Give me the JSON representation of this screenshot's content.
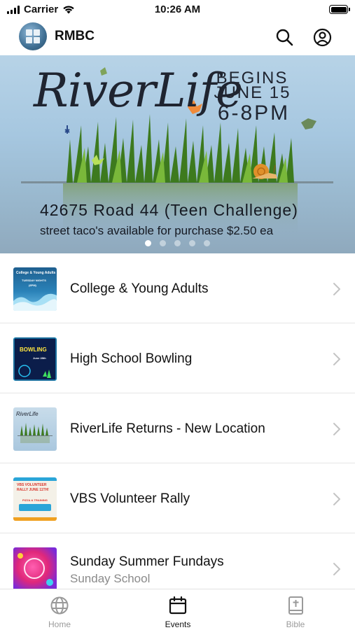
{
  "status_bar": {
    "carrier": "Carrier",
    "time": "10:26 AM"
  },
  "header": {
    "title": "RMBC",
    "icons": [
      "search-icon",
      "account-icon"
    ]
  },
  "banner": {
    "script_title": "RiverLife",
    "begins": "BEGINS",
    "date": "JUNE 15",
    "time": "6-8PM",
    "address": "42675 Road 44 (Teen Challenge)",
    "subtitle": "street taco's available for purchase $2.50 ea",
    "page_count": 5,
    "active_page": 1
  },
  "events": [
    {
      "title": "College & Young Adults",
      "subtitle": "",
      "thumb": {
        "line1": "College & Young Adults",
        "line2": "TUESDAY NIGHTS",
        "line3": "(6PM)"
      }
    },
    {
      "title": "High School Bowling",
      "subtitle": "",
      "thumb": {
        "line1": "BOWLING",
        "line2": "June 28th"
      }
    },
    {
      "title": "RiverLife Returns - New Location",
      "subtitle": "",
      "thumb": {
        "line1": "RiverLife"
      }
    },
    {
      "title": "VBS Volunteer Rally",
      "subtitle": "",
      "thumb": {
        "line1": "VBS VOLUNTEER",
        "line2": "RALLY JUNE 11TH!",
        "line3": "PIZZA & TRAINING"
      }
    },
    {
      "title": "Sunday Summer Fundays",
      "subtitle": "Sunday School",
      "thumb": {}
    }
  ],
  "tab_bar": {
    "tabs": [
      {
        "label": "Home",
        "icon": "globe-icon"
      },
      {
        "label": "Events",
        "icon": "calendar-icon"
      },
      {
        "label": "Bible",
        "icon": "bible-icon"
      }
    ],
    "active": "Events"
  },
  "colors": {
    "text_primary": "#111111",
    "text_secondary": "#8a8a8a",
    "tab_inactive": "#9a9a9a",
    "divider": "#e6e6e6",
    "banner_sky": "#a6c7e0"
  }
}
